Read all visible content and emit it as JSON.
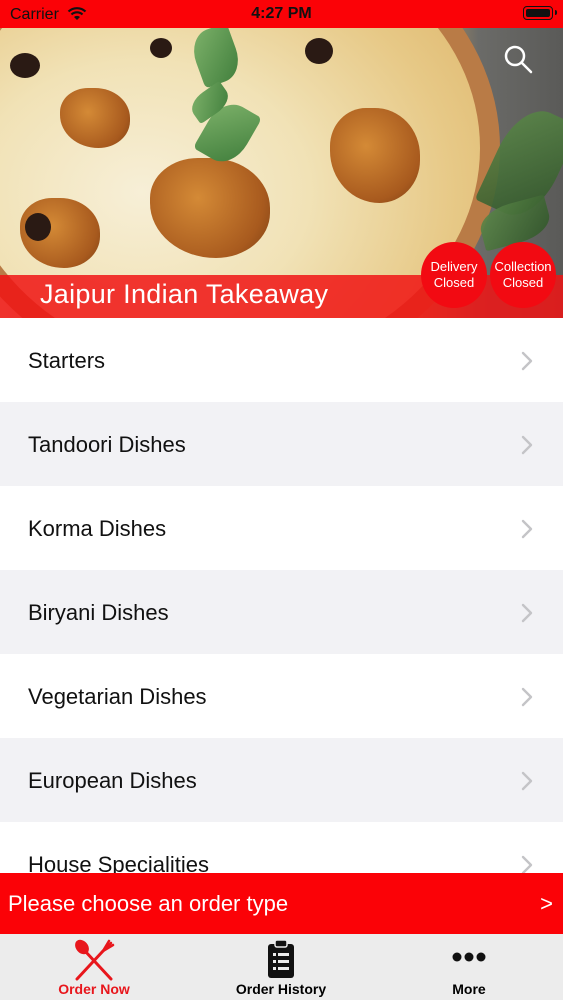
{
  "status_bar": {
    "carrier": "Carrier",
    "time": "4:27 PM"
  },
  "header": {
    "restaurant_name": "Jaipur Indian Takeaway",
    "delivery_badge": {
      "line1": "Delivery",
      "line2": "Closed"
    },
    "collection_badge": {
      "line1": "Collection",
      "line2": "Closed"
    }
  },
  "menu": {
    "items": [
      {
        "label": "Starters"
      },
      {
        "label": "Tandoori Dishes"
      },
      {
        "label": "Korma Dishes"
      },
      {
        "label": "Biryani Dishes"
      },
      {
        "label": "Vegetarian Dishes"
      },
      {
        "label": "European Dishes"
      },
      {
        "label": "House Specialities"
      }
    ]
  },
  "order_bar": {
    "text": "Please choose an order type",
    "arrow": ">"
  },
  "tab_bar": {
    "tabs": [
      {
        "label": "Order Now",
        "icon": "fork-knife-icon",
        "active": true
      },
      {
        "label": "Order History",
        "icon": "clipboard-list-icon",
        "active": false
      },
      {
        "label": "More",
        "icon": "more-dots-icon",
        "active": false
      }
    ]
  },
  "colors": {
    "brand_red": "#fb0207",
    "active_tab": "#e8161c",
    "alt_row": "#f2f2f5"
  }
}
